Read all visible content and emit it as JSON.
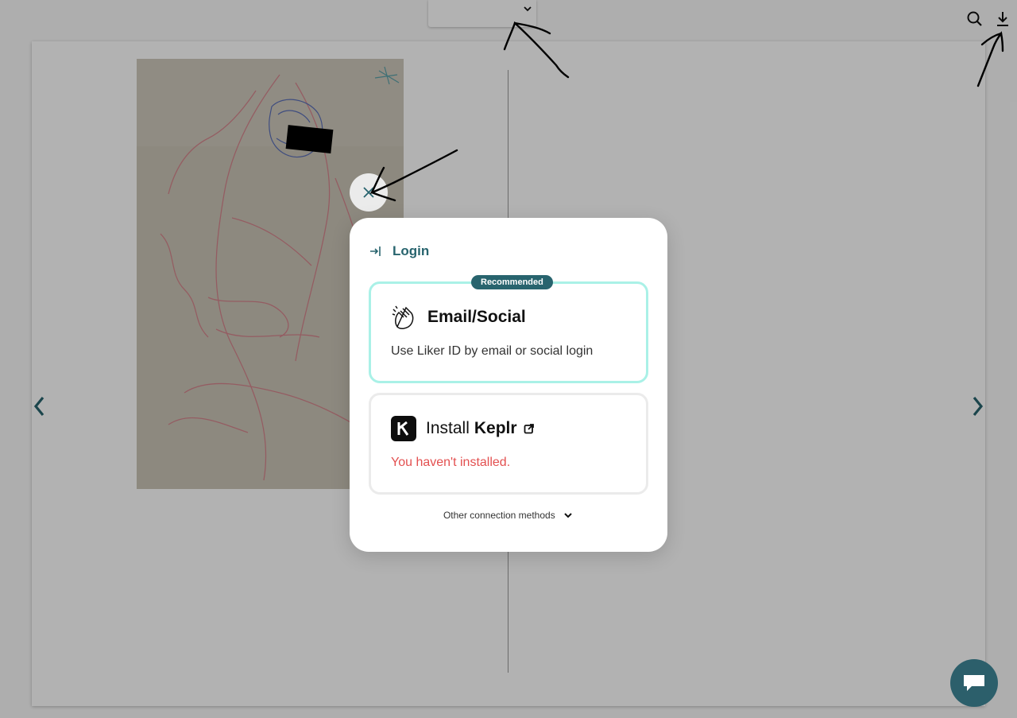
{
  "reader": {
    "prev_icon": "chevron-left-icon",
    "next_icon": "chevron-right-icon",
    "search_icon": "search-icon",
    "download_icon": "download-icon",
    "dropdown_icon": "chevron-down-icon"
  },
  "modal": {
    "close_icon": "close-icon",
    "login_label": "Login",
    "options": [
      {
        "badge": "Recommended",
        "title": "Email/Social",
        "description": "Use Liker ID by email or social login"
      },
      {
        "title_prefix": "Install",
        "title": "Keplr",
        "status": "You haven't installed."
      }
    ],
    "other_methods_label": "Other connection methods"
  },
  "colors": {
    "accent": "#28646e",
    "recommended_border": "#aaf1e7",
    "warning": "#e35050",
    "chat": "#2c5f6b"
  }
}
